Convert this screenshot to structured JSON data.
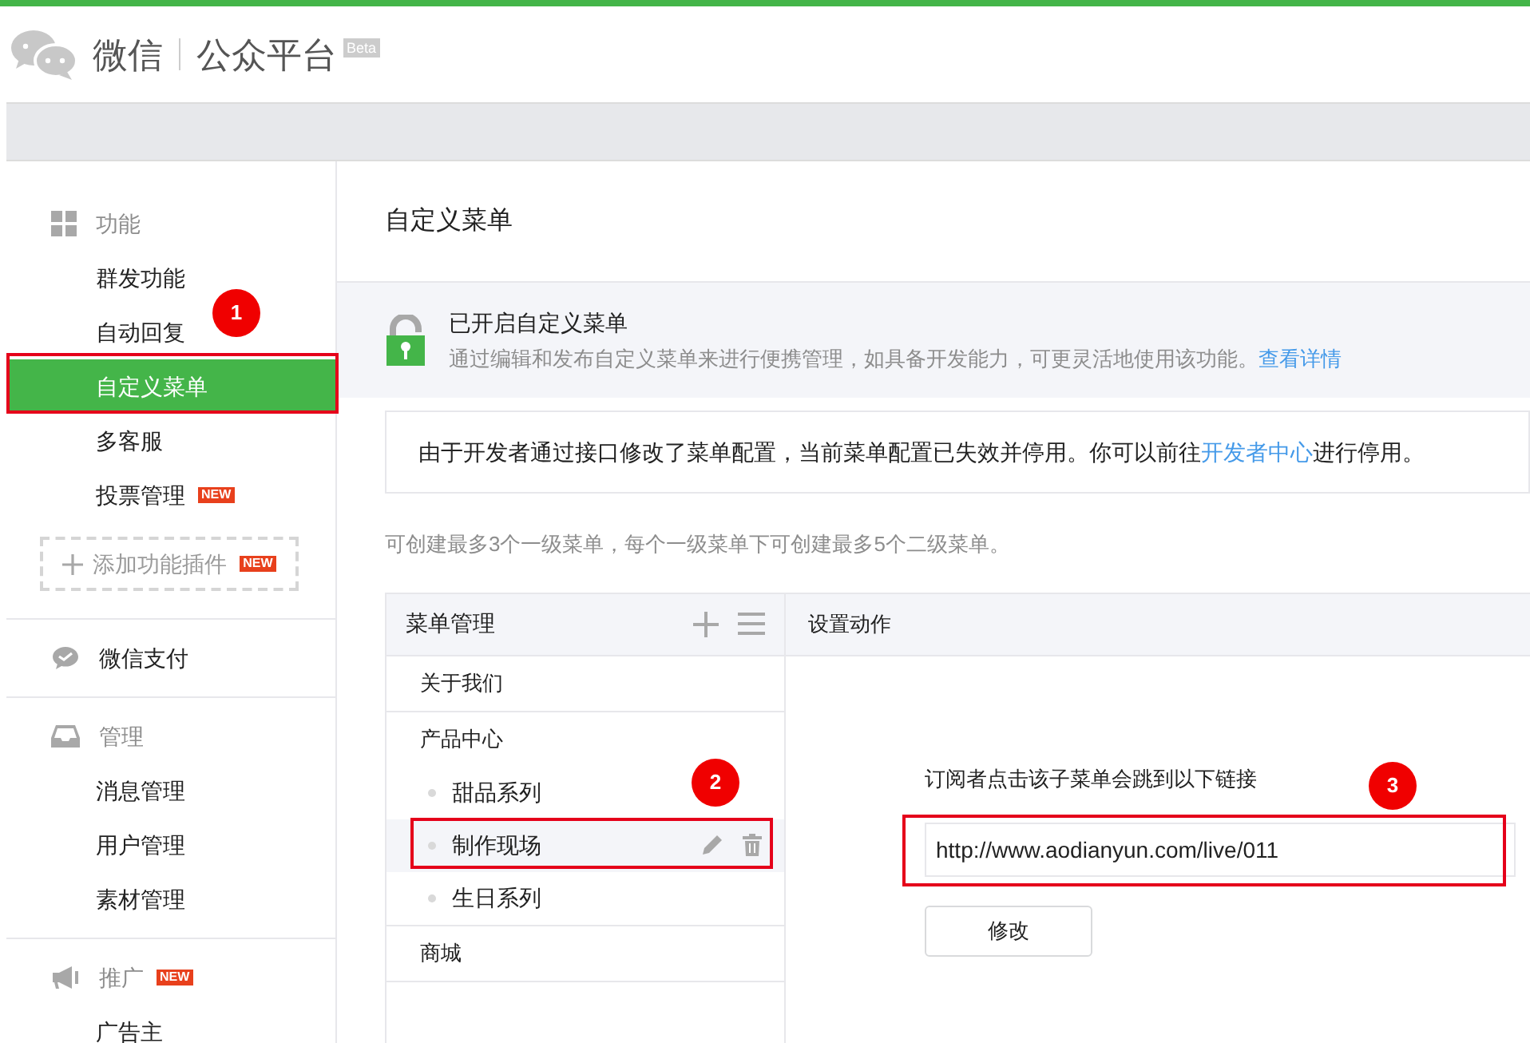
{
  "header": {
    "brand": "微信",
    "product": "公众平台",
    "badge": "Beta"
  },
  "sidebar": {
    "sections": [
      {
        "label": "功能",
        "items": [
          {
            "label": "群发功能",
            "selected": false
          },
          {
            "label": "自动回复",
            "selected": false
          },
          {
            "label": "自定义菜单",
            "selected": true
          },
          {
            "label": "多客服",
            "selected": false
          },
          {
            "label": "投票管理",
            "selected": false,
            "badge": "NEW"
          }
        ],
        "add_button": {
          "label": "添加功能插件",
          "badge": "NEW"
        }
      },
      {
        "label": "微信支付"
      },
      {
        "label": "管理",
        "items": [
          {
            "label": "消息管理",
            "selected": false
          },
          {
            "label": "用户管理",
            "selected": false
          },
          {
            "label": "素材管理",
            "selected": false
          }
        ]
      },
      {
        "label": "推广",
        "badge": "NEW",
        "items": [
          {
            "label": "广告主",
            "selected": false
          }
        ]
      }
    ]
  },
  "page_title": "自定义菜单",
  "status": {
    "title": "已开启自定义菜单",
    "description": "通过编辑和发布自定义菜单来进行便携管理，如具备开发能力，可更灵活地使用该功能。",
    "link": "查看详情"
  },
  "notice": {
    "before": "由于开发者通过接口修改了菜单配置，当前菜单配置已失效并停用。你可以前往",
    "link": "开发者中心",
    "after": "进行停用。"
  },
  "hint": "可创建最多3个一级菜单，每个一级菜单下可创建最多5个二级菜单。",
  "menu_panel": {
    "title": "菜单管理",
    "items": [
      {
        "label": "关于我们",
        "selected": false
      },
      {
        "label": "产品中心",
        "selected": false,
        "children": [
          {
            "label": "甜品系列",
            "selected": false
          },
          {
            "label": "制作现场",
            "selected": true
          },
          {
            "label": "生日系列",
            "selected": false
          }
        ]
      },
      {
        "label": "商城",
        "selected": false
      }
    ]
  },
  "action_panel": {
    "title": "设置动作",
    "label": "订阅者点击该子菜单会跳到以下链接",
    "url": "http://www.aodianyun.com/live/011",
    "button": "修改"
  },
  "callouts": [
    {
      "label": "1"
    },
    {
      "label": "2"
    },
    {
      "label": "3"
    }
  ]
}
